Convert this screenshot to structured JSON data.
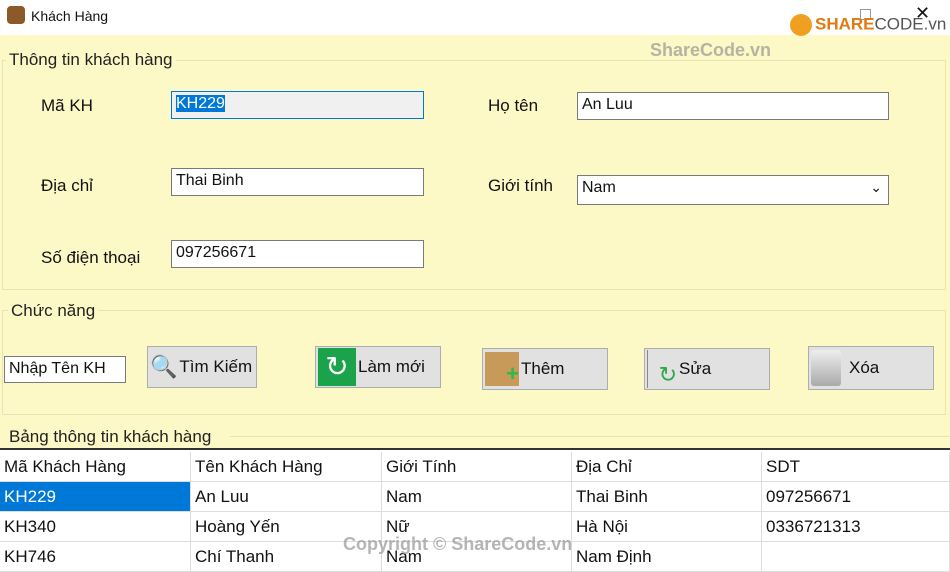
{
  "window": {
    "title": "Khách Hàng"
  },
  "watermark": {
    "logo": "SHARECODE.vn",
    "text": "ShareCode.vn",
    "copyright": "Copyright © ShareCode.vn"
  },
  "info_group": {
    "title": "Thông tin khách hàng",
    "ma_kh_label": "Mã KH",
    "ma_kh_value": "KH229",
    "ho_ten_label": "Họ tên",
    "ho_ten_value": "An Luu",
    "dia_chi_label": "Địa chỉ",
    "dia_chi_value": "Thai Binh",
    "gioi_tinh_label": "Giới tính",
    "gioi_tinh_value": "Nam",
    "sdt_label": "Số điện thoại",
    "sdt_value": "097256671"
  },
  "func_group": {
    "title": "Chức năng",
    "search_value": "Nhập Tên KH",
    "buttons": {
      "search": "Tìm Kiếm",
      "refresh": "Làm mới",
      "add": "Thêm",
      "edit": "Sửa",
      "delete": "Xóa"
    }
  },
  "table": {
    "title": "Bảng thông tin khách hàng",
    "headers": [
      "Mã Khách Hàng",
      "Tên Khách Hàng",
      "Giới Tính",
      "Địa Chỉ",
      "SDT"
    ],
    "rows": [
      [
        "KH229",
        "An Luu",
        "Nam",
        "Thai Binh",
        "097256671"
      ],
      [
        "KH340",
        "Hoàng Yến",
        "Nữ",
        "Hà Nội",
        "0336721313"
      ],
      [
        "KH746",
        "Chí Thanh",
        "Nam",
        "Nam Định",
        ""
      ]
    ]
  },
  "colors": {
    "background": "#fcf9c6",
    "selection": "#0078d7"
  }
}
